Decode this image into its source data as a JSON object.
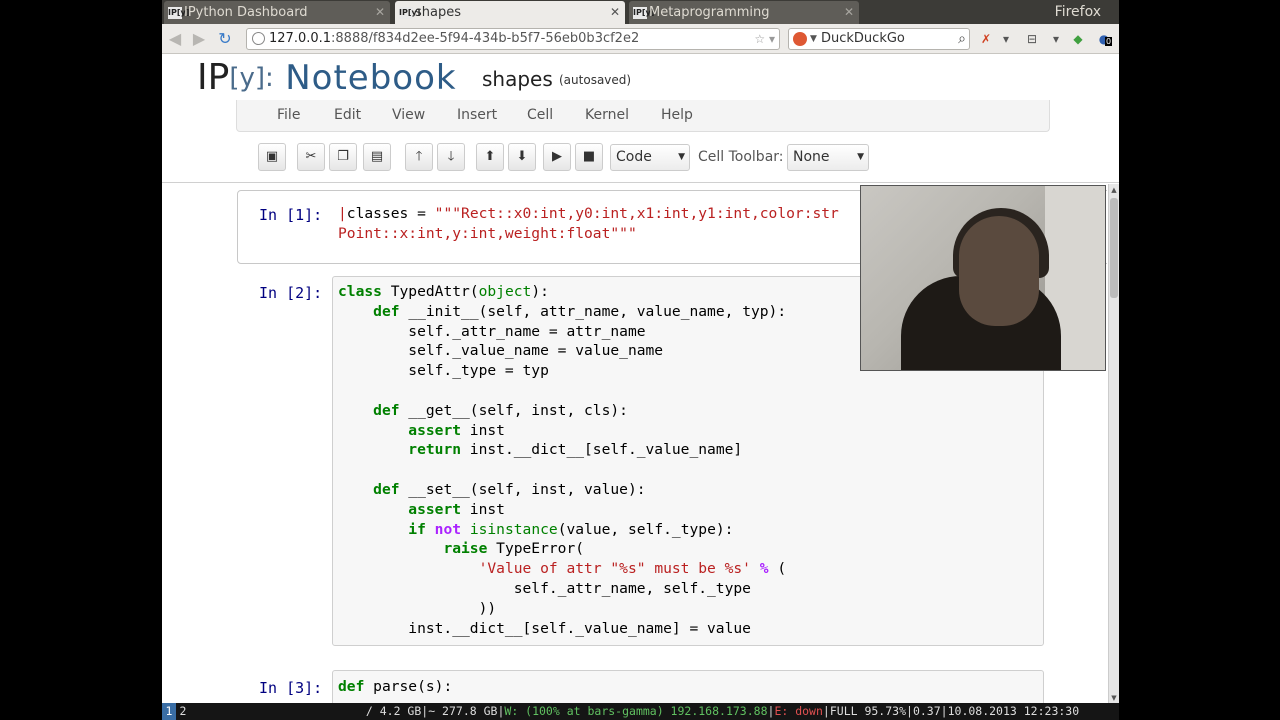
{
  "browser": {
    "window_title": "Firefox",
    "tabs": [
      {
        "label": "IPython Dashboard",
        "favicon": "IP[y]"
      },
      {
        "label": "shapes",
        "favicon": "IP[y]"
      },
      {
        "label": "Metaprogramming",
        "favicon": "IP[y]"
      }
    ],
    "url_host": "127.0.0.1",
    "url_rest": ":8888/f834d2ee-5f94-434b-b5f7-56eb0b3cf2e2",
    "search_engine": "DuckDuckGo",
    "badge_count": "0"
  },
  "notebook": {
    "logo_ip": "IP",
    "logo_y": "[y]:",
    "logo_notebook": "Notebook",
    "name": "shapes",
    "autosave": "(autosaved)",
    "menu": [
      "File",
      "Edit",
      "View",
      "Insert",
      "Cell",
      "Kernel",
      "Help"
    ],
    "cell_type": "Code",
    "cell_toolbar_label": "Cell Toolbar:",
    "cell_toolbar_value": "None"
  },
  "cells": [
    {
      "prompt": "In [1]:"
    },
    {
      "prompt": "In [2]:"
    },
    {
      "prompt": "In [3]:"
    }
  ],
  "statusbar": {
    "workspaces": [
      "1",
      "2"
    ],
    "disk_root": "/ 4.2 GB",
    "disk_home": "~ 277.8 GB",
    "wifi": "W: (100% at bars-gamma) 192.168.173.88",
    "eth": "E: down",
    "battery": "FULL 95.73%",
    "load": "0.37",
    "datetime": "10.08.2013 12:23:30"
  },
  "colors": {
    "keyword": "#008000",
    "string": "#ba2121",
    "prompt": "#000080",
    "logo_blue": "#2e5c87"
  }
}
